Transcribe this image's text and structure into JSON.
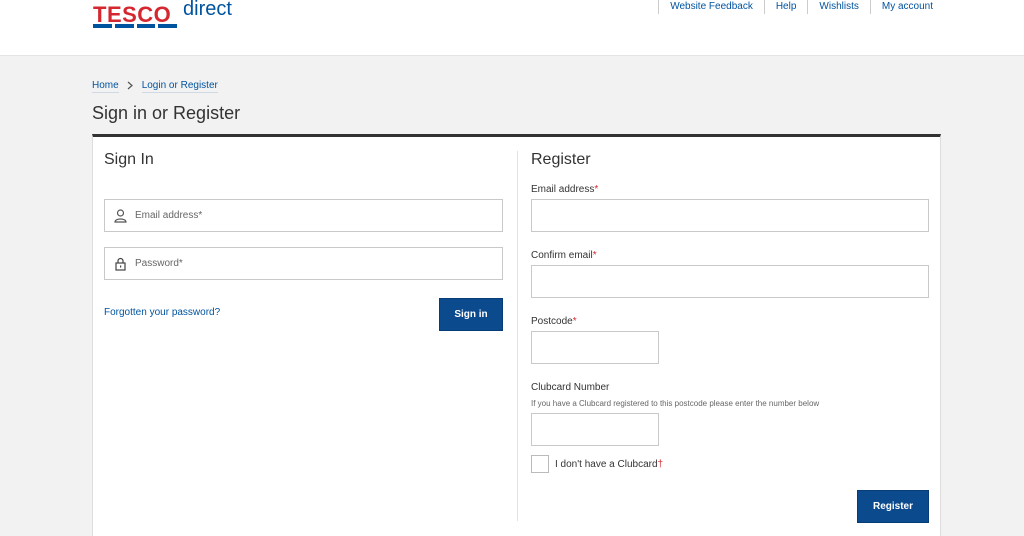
{
  "header": {
    "brand": "TESCO",
    "brand_suffix": "direct",
    "nav": [
      "Website Feedback",
      "Help",
      "Wishlists",
      "My account"
    ]
  },
  "breadcrumb": {
    "home": "Home",
    "separator": ">",
    "current": "Login or Register"
  },
  "page_title": "Sign in or Register",
  "signin": {
    "heading": "Sign In",
    "email_placeholder": "Email address*",
    "password_placeholder": "Password*",
    "forgot_link": "Forgotten your password?",
    "submit_label": "Sign in"
  },
  "register": {
    "heading": "Register",
    "email_label": "Email address",
    "confirm_email_label": "Confirm email",
    "postcode_label": "Postcode",
    "required_marker": "*",
    "clubcard_label": "Clubcard Number",
    "clubcard_hint": "If you have a Clubcard registered to this postcode please enter the number below",
    "no_clubcard_label": "I don't have a Clubcard",
    "no_clubcard_marker": "†",
    "submit_label": "Register"
  },
  "colors": {
    "brand_blue": "#00539f",
    "brand_red": "#d5272f",
    "button_blue": "#0c4a8e"
  }
}
